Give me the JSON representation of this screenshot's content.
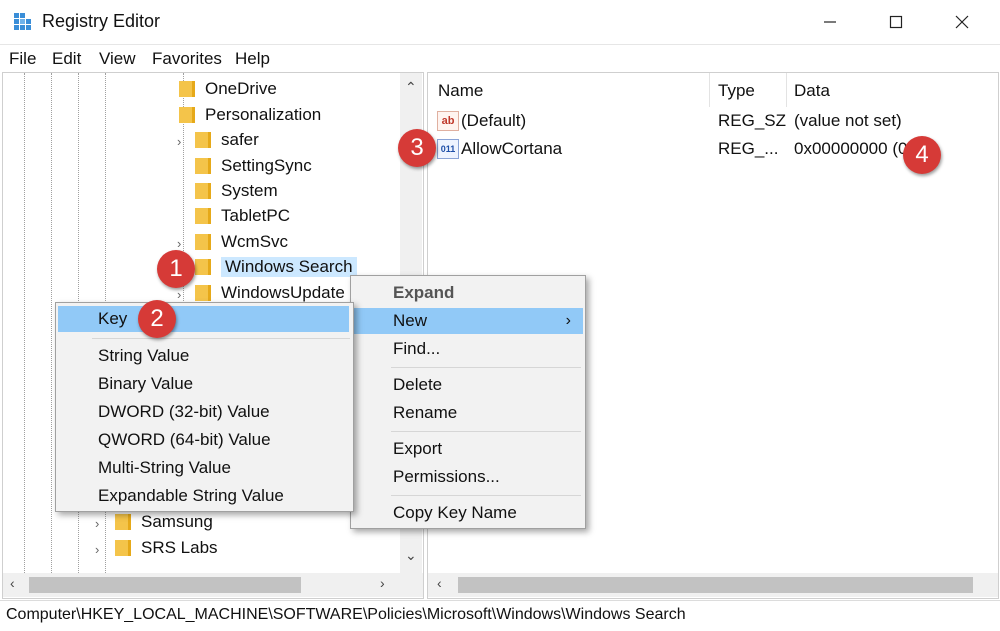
{
  "window": {
    "title": "Registry Editor"
  },
  "menu": [
    "File",
    "Edit",
    "View",
    "Favorites",
    "Help"
  ],
  "tree": {
    "items": [
      {
        "label": "OneDrive",
        "expandable": false
      },
      {
        "label": "Personalization",
        "expandable": false
      },
      {
        "label": "safer",
        "expandable": true
      },
      {
        "label": "SettingSync",
        "expandable": false
      },
      {
        "label": "System",
        "expandable": false
      },
      {
        "label": "TabletPC",
        "expandable": false
      },
      {
        "label": "WcmSvc",
        "expandable": true
      },
      {
        "label": "Windows Search",
        "expandable": false,
        "selected": true
      },
      {
        "label": "WindowsUpdate",
        "expandable": true
      }
    ],
    "bottom_items": [
      {
        "label": "Samsung",
        "expandable": true
      },
      {
        "label": "SRS Labs",
        "expandable": true
      }
    ]
  },
  "list": {
    "headers": {
      "name": "Name",
      "type": "Type",
      "data": "Data"
    },
    "rows": [
      {
        "icon": "ab",
        "name": "(Default)",
        "type": "REG_SZ",
        "data": "(value not set)"
      },
      {
        "icon": "011",
        "name": "AllowCortana",
        "type": "REG_...",
        "data": "0x00000000 (0"
      }
    ]
  },
  "context_menu": {
    "items": [
      "Expand",
      "New",
      "Find...",
      "Delete",
      "Rename",
      "Export",
      "Permissions...",
      "Copy Key Name"
    ],
    "submenu_arrow": "›"
  },
  "new_submenu": {
    "items": [
      "Key",
      "String Value",
      "Binary Value",
      "DWORD (32-bit) Value",
      "QWORD (64-bit) Value",
      "Multi-String Value",
      "Expandable String Value"
    ]
  },
  "markers": [
    "1",
    "2",
    "3",
    "4"
  ],
  "status": {
    "path": "Computer\\HKEY_LOCAL_MACHINE\\SOFTWARE\\Policies\\Microsoft\\Windows\\Windows Search"
  },
  "colors": {
    "selection": "#cce8ff",
    "menu_highlight": "#91c9f7",
    "marker": "#d63a37",
    "folder": "#f4c44a"
  }
}
